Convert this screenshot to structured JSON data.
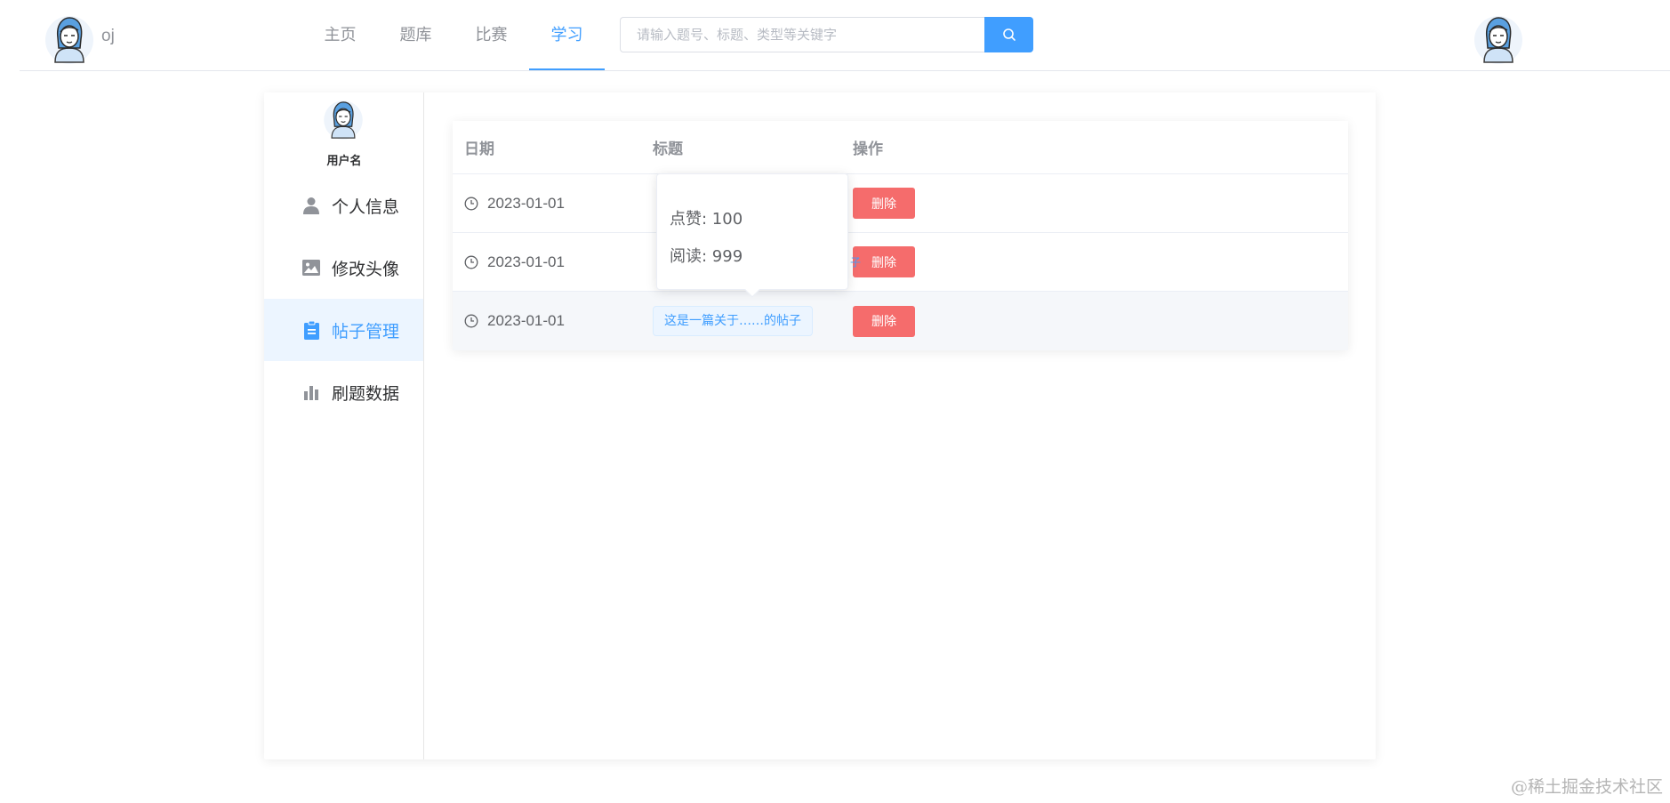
{
  "header": {
    "logo_text": "oj",
    "nav": [
      {
        "label": "主页",
        "active": false
      },
      {
        "label": "题库",
        "active": false
      },
      {
        "label": "比赛",
        "active": false
      },
      {
        "label": "学习",
        "active": true
      }
    ],
    "search": {
      "placeholder": "请输入题号、标题、类型等关键字",
      "value": "",
      "icon": "search-icon"
    },
    "user_avatar_icon": "girl-avatar-icon"
  },
  "sidebar": {
    "username": "用户名",
    "items": [
      {
        "label": "个人信息",
        "icon": "user-icon",
        "active": false
      },
      {
        "label": "修改头像",
        "icon": "image-icon",
        "active": false
      },
      {
        "label": "帖子管理",
        "icon": "clipboard-icon",
        "active": true
      },
      {
        "label": "刷题数据",
        "icon": "bar-chart-icon",
        "active": false
      }
    ]
  },
  "table": {
    "headers": {
      "date": "日期",
      "title": "标题",
      "op": "操作"
    },
    "rows": [
      {
        "date": "2023-01-01",
        "title": "",
        "action": "删除"
      },
      {
        "date": "2023-01-01",
        "title": "",
        "action": "删除"
      },
      {
        "date": "2023-01-01",
        "title": "这是一篇关于……的帖子",
        "action": "删除"
      }
    ]
  },
  "popover": {
    "likes": "点赞: 100",
    "reads": "阅读: 999",
    "peek_text": "子"
  },
  "watermark": "@稀土掘金技术社区",
  "colors": {
    "accent": "#409eff",
    "danger": "#f56c6c",
    "active_bg": "#ecf5ff"
  }
}
